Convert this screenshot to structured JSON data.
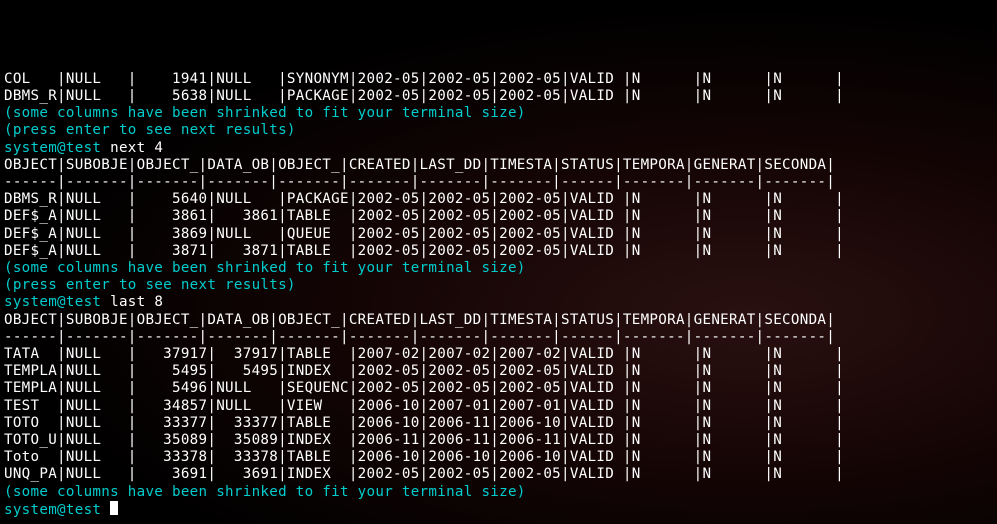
{
  "columns": [
    "OBJECT",
    "SUBOBJE",
    "OBJECT_",
    "DATA_OB",
    "OBJECT_",
    "CREATED",
    "LAST_DD",
    "TIMESTA",
    "STATUS",
    "TEMPORA",
    "GENERAT",
    "SECONDA"
  ],
  "messages": {
    "shrinked": "(some columns have been shrinked to fit your terminal size)",
    "press_enter": "(press enter to see next results)"
  },
  "prompt_prefix": "system@test",
  "blocks": [
    {
      "rows_above_visible": [
        {
          "OBJECT": "COL",
          "SUBOBJE": "NULL",
          "OBJECT_N": "1941",
          "DATA_OB": "NULL",
          "OBJECT_T": "SYNONYM",
          "CREATED": "2002-05",
          "LAST_DD": "2002-05",
          "TIMESTA": "2002-05",
          "STATUS": "VALID",
          "TEMPORA": "N",
          "GENERAT": "N",
          "SECONDA": "N"
        },
        {
          "OBJECT": "DBMS_R",
          "SUBOBJE": "NULL",
          "OBJECT_N": "5638",
          "DATA_OB": "NULL",
          "OBJECT_T": "PACKAGE",
          "CREATED": "2002-05",
          "LAST_DD": "2002-05",
          "TIMESTA": "2002-05",
          "STATUS": "VALID",
          "TEMPORA": "N",
          "GENERAT": "N",
          "SECONDA": "N"
        }
      ]
    },
    {
      "command": "next 4",
      "rows": [
        {
          "OBJECT": "DBMS_R",
          "SUBOBJE": "NULL",
          "OBJECT_N": "5640",
          "DATA_OB": "NULL",
          "OBJECT_T": "PACKAGE",
          "CREATED": "2002-05",
          "LAST_DD": "2002-05",
          "TIMESTA": "2002-05",
          "STATUS": "VALID",
          "TEMPORA": "N",
          "GENERAT": "N",
          "SECONDA": "N"
        },
        {
          "OBJECT": "DEF$_A",
          "SUBOBJE": "NULL",
          "OBJECT_N": "3861",
          "DATA_OB": "3861",
          "OBJECT_T": "TABLE",
          "CREATED": "2002-05",
          "LAST_DD": "2002-05",
          "TIMESTA": "2002-05",
          "STATUS": "VALID",
          "TEMPORA": "N",
          "GENERAT": "N",
          "SECONDA": "N"
        },
        {
          "OBJECT": "DEF$_A",
          "SUBOBJE": "NULL",
          "OBJECT_N": "3869",
          "DATA_OB": "NULL",
          "OBJECT_T": "QUEUE",
          "CREATED": "2002-05",
          "LAST_DD": "2002-05",
          "TIMESTA": "2002-05",
          "STATUS": "VALID",
          "TEMPORA": "N",
          "GENERAT": "N",
          "SECONDA": "N"
        },
        {
          "OBJECT": "DEF$_A",
          "SUBOBJE": "NULL",
          "OBJECT_N": "3871",
          "DATA_OB": "3871",
          "OBJECT_T": "TABLE",
          "CREATED": "2002-05",
          "LAST_DD": "2002-05",
          "TIMESTA": "2002-05",
          "STATUS": "VALID",
          "TEMPORA": "N",
          "GENERAT": "N",
          "SECONDA": "N"
        }
      ]
    },
    {
      "command": "last 8",
      "rows": [
        {
          "OBJECT": "TATA",
          "SUBOBJE": "NULL",
          "OBJECT_N": "37917",
          "DATA_OB": "37917",
          "OBJECT_T": "TABLE",
          "CREATED": "2007-02",
          "LAST_DD": "2007-02",
          "TIMESTA": "2007-02",
          "STATUS": "VALID",
          "TEMPORA": "N",
          "GENERAT": "N",
          "SECONDA": "N"
        },
        {
          "OBJECT": "TEMPLA",
          "SUBOBJE": "NULL",
          "OBJECT_N": "5495",
          "DATA_OB": "5495",
          "OBJECT_T": "INDEX",
          "CREATED": "2002-05",
          "LAST_DD": "2002-05",
          "TIMESTA": "2002-05",
          "STATUS": "VALID",
          "TEMPORA": "N",
          "GENERAT": "N",
          "SECONDA": "N"
        },
        {
          "OBJECT": "TEMPLA",
          "SUBOBJE": "NULL",
          "OBJECT_N": "5496",
          "DATA_OB": "NULL",
          "OBJECT_T": "SEQUENC",
          "CREATED": "2002-05",
          "LAST_DD": "2002-05",
          "TIMESTA": "2002-05",
          "STATUS": "VALID",
          "TEMPORA": "N",
          "GENERAT": "N",
          "SECONDA": "N"
        },
        {
          "OBJECT": "TEST",
          "SUBOBJE": "NULL",
          "OBJECT_N": "34857",
          "DATA_OB": "NULL",
          "OBJECT_T": "VIEW",
          "CREATED": "2006-10",
          "LAST_DD": "2007-01",
          "TIMESTA": "2007-01",
          "STATUS": "VALID",
          "TEMPORA": "N",
          "GENERAT": "N",
          "SECONDA": "N"
        },
        {
          "OBJECT": "TOTO",
          "SUBOBJE": "NULL",
          "OBJECT_N": "33377",
          "DATA_OB": "33377",
          "OBJECT_T": "TABLE",
          "CREATED": "2006-10",
          "LAST_DD": "2006-11",
          "TIMESTA": "2006-10",
          "STATUS": "VALID",
          "TEMPORA": "N",
          "GENERAT": "N",
          "SECONDA": "N"
        },
        {
          "OBJECT": "TOTO_U",
          "SUBOBJE": "NULL",
          "OBJECT_N": "35089",
          "DATA_OB": "35089",
          "OBJECT_T": "INDEX",
          "CREATED": "2006-11",
          "LAST_DD": "2006-11",
          "TIMESTA": "2006-11",
          "STATUS": "VALID",
          "TEMPORA": "N",
          "GENERAT": "N",
          "SECONDA": "N"
        },
        {
          "OBJECT": "Toto",
          "SUBOBJE": "NULL",
          "OBJECT_N": "33378",
          "DATA_OB": "33378",
          "OBJECT_T": "TABLE",
          "CREATED": "2006-10",
          "LAST_DD": "2006-10",
          "TIMESTA": "2006-10",
          "STATUS": "VALID",
          "TEMPORA": "N",
          "GENERAT": "N",
          "SECONDA": "N"
        },
        {
          "OBJECT": "UNQ_PA",
          "SUBOBJE": "NULL",
          "OBJECT_N": "3691",
          "DATA_OB": "3691",
          "OBJECT_T": "INDEX",
          "CREATED": "2002-05",
          "LAST_DD": "2002-05",
          "TIMESTA": "2002-05",
          "STATUS": "VALID",
          "TEMPORA": "N",
          "GENERAT": "N",
          "SECONDA": "N"
        }
      ]
    }
  ],
  "final_prompt": "system@test "
}
